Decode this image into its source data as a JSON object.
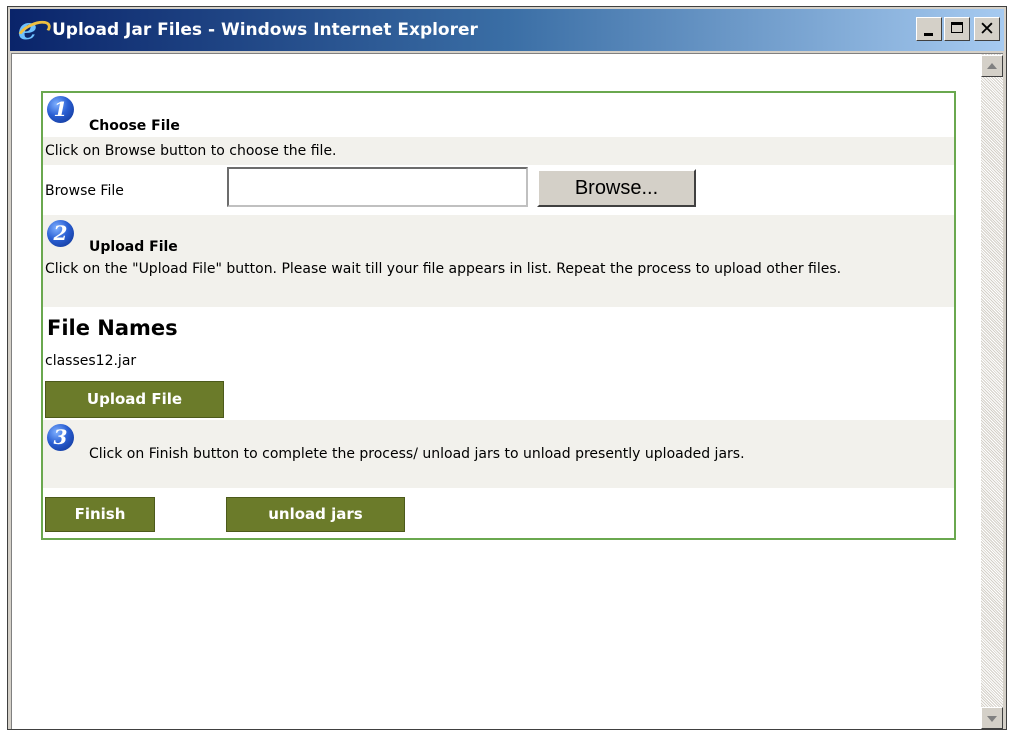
{
  "window": {
    "title": "Upload Jar Files - Windows Internet Explorer"
  },
  "step1": {
    "number": "1",
    "heading": "Choose File",
    "instruction": "Click on Browse button to choose the file.",
    "browse_label": "Browse File",
    "file_input_value": "",
    "browse_button": "Browse..."
  },
  "step2": {
    "number": "2",
    "heading": "Upload File",
    "instruction": "Click on the \"Upload File\" button. Please wait till your file appears in list. Repeat the process to upload other files.",
    "file_names_heading": "File Names",
    "files": [
      "classes12.jar"
    ],
    "upload_button": "Upload File"
  },
  "step3": {
    "number": "3",
    "instruction": "Click on Finish button to complete the process/ unload jars to unload presently uploaded jars.",
    "finish_button": "Finish",
    "unload_button": "unload jars"
  },
  "colors": {
    "titlebar_start": "#0a246a",
    "panel_border": "#6aa84f",
    "button_green": "#6b7b2a",
    "row_gray": "#f2f1ec"
  },
  "icons": [
    "internet-explorer-icon",
    "minimize-icon",
    "maximize-icon",
    "close-icon",
    "scroll-up-arrow-icon",
    "scroll-down-arrow-icon"
  ]
}
